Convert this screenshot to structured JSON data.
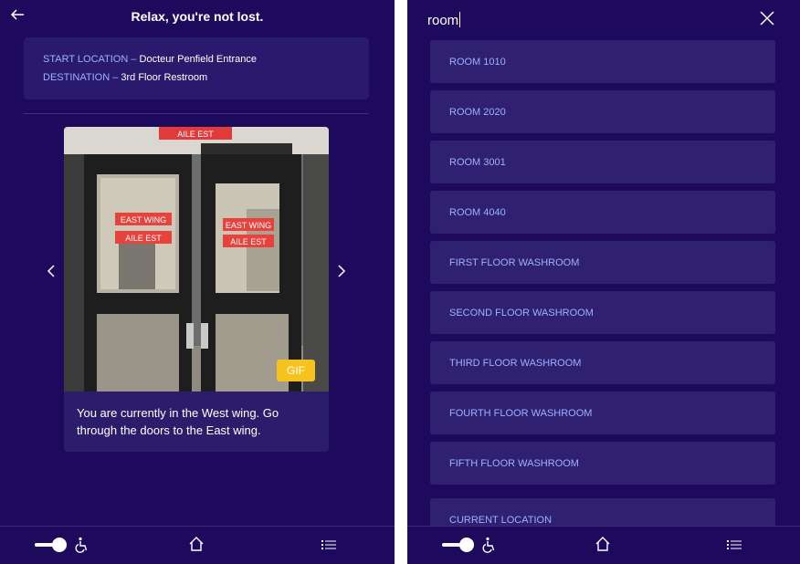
{
  "left": {
    "title": "Relax, you're not lost.",
    "start_label": "START LOCATION –",
    "start_value": " Docteur Penfield Entrance",
    "dest_label": "DESTINATION –",
    "dest_value": " 3rd Floor Restroom",
    "photo_signs": [
      "AILE EST",
      "EAST WING",
      "AILE EST",
      "EAST WING",
      "AILE EST"
    ],
    "gif_label": "GIF",
    "caption": "You are currently in the West wing. Go through the doors to the East wing."
  },
  "right": {
    "search_value": "room",
    "results": [
      "ROOM 1010",
      "ROOM 2020",
      "ROOM 3001",
      "ROOM 4040",
      "FIRST FLOOR WASHROOM",
      "SECOND FLOOR WASHROOM",
      "THIRD FLOOR WASHROOM",
      "FOURTH FLOOR WASHROOM",
      "FIFTH FLOOR WASHROOM",
      "CURRENT LOCATION"
    ]
  },
  "colors": {
    "background": "#1d0a5c",
    "card": "#2c1c6c",
    "accent_text": "#9cb2ff",
    "gif_button": "#f6c21d"
  },
  "icons": [
    "back-arrow-icon",
    "chevron-left-icon",
    "chevron-right-icon",
    "accessibility-toggle-icon",
    "wheelchair-icon",
    "home-icon",
    "list-icon",
    "close-icon"
  ]
}
